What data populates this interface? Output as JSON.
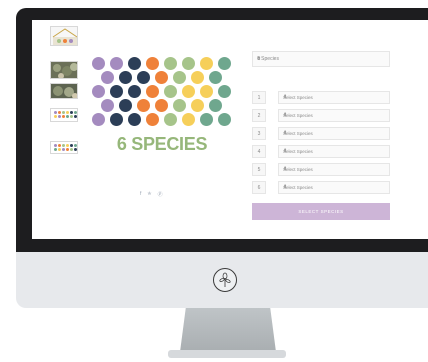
{
  "product": {
    "species_label": "6 SPECIES"
  },
  "form": {
    "main_select_value": "6 Species",
    "rows": [
      {
        "num": "1",
        "placeholder": "Select Species"
      },
      {
        "num": "2",
        "placeholder": "Select Species"
      },
      {
        "num": "3",
        "placeholder": "Select Species"
      },
      {
        "num": "4",
        "placeholder": "Select Species"
      },
      {
        "num": "5",
        "placeholder": "Select Species"
      },
      {
        "num": "6",
        "placeholder": "Select Species"
      }
    ],
    "submit_label": "SELECT SPECIES"
  },
  "share": {
    "facebook": "f",
    "twitter": "✯",
    "pinterest": "Ⓟ"
  },
  "colors": {
    "purple": "#a48bbf",
    "navy": "#2c3e57",
    "orange": "#ef8139",
    "sage": "#a6c48a",
    "teal": "#6fa78e",
    "yellow": "#f6cf5a",
    "button": "#cdb5d7"
  },
  "icons": [
    "flower-logo-icon",
    "facebook-icon",
    "twitter-icon",
    "pinterest-icon",
    "caret-icon"
  ]
}
